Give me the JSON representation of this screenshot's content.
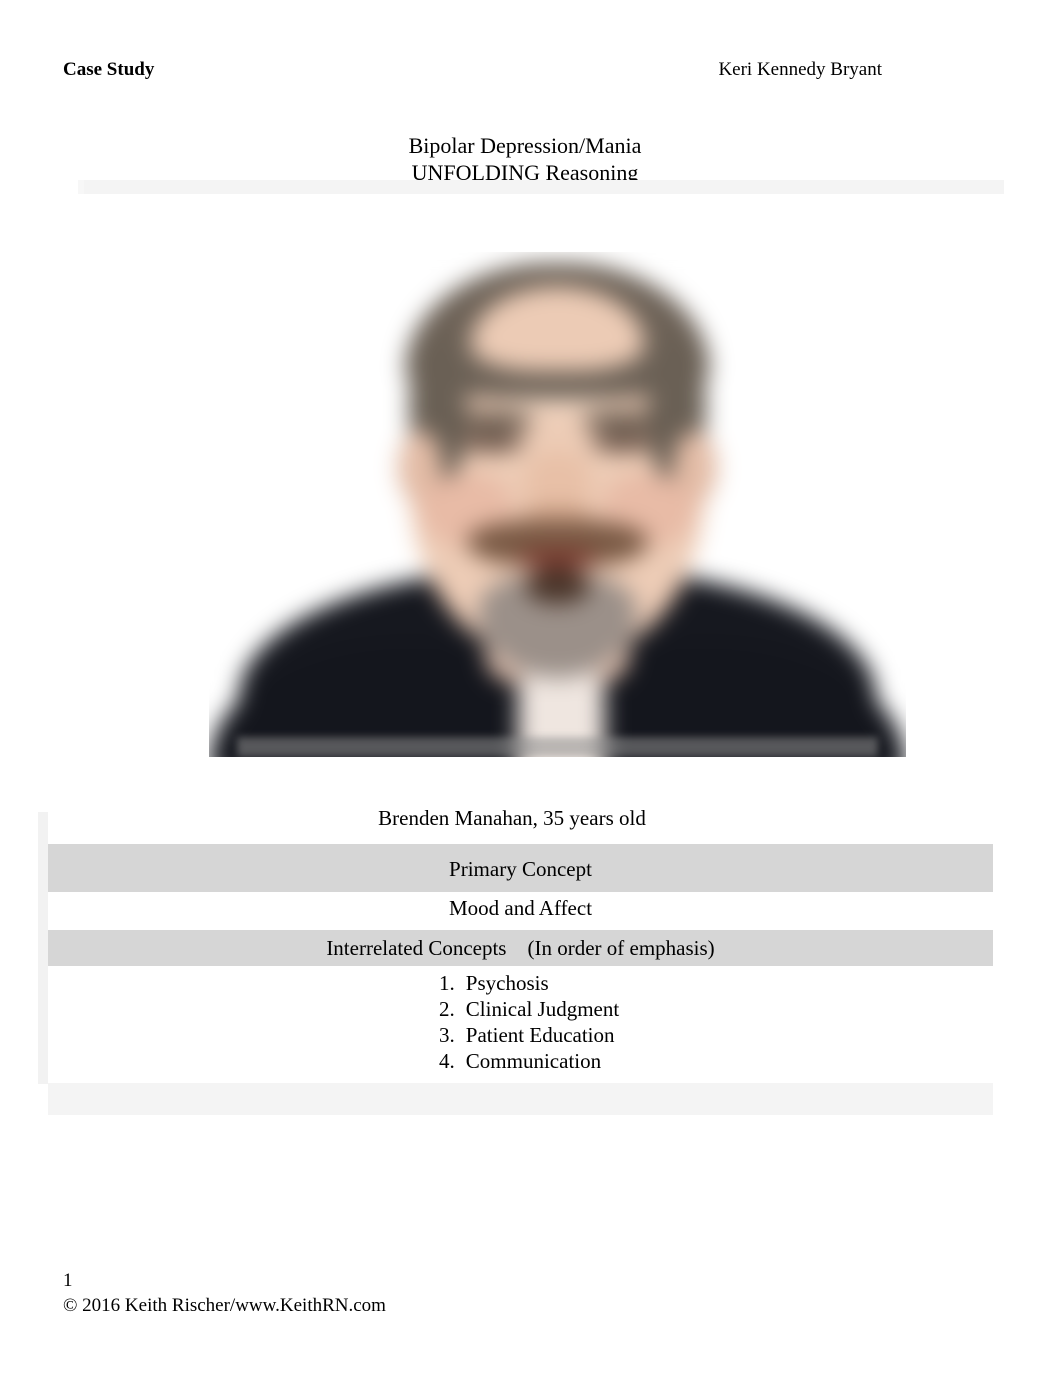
{
  "document": {
    "header": {
      "left_label": "Case Study",
      "right_label": "Keri Kennedy Bryant"
    },
    "title": {
      "line1": "Bipolar Depression/Mania",
      "line2": "UNFOLDING Reasoning"
    },
    "photo": {
      "alt": "Portrait photograph of a middle-aged man with a grey goatee wearing a dark collared shirt",
      "icon_name": "patient-portrait"
    },
    "caption": "Brenden Manahan, 35 years old",
    "concept_table": {
      "primary_concept_label": "Primary Concept",
      "primary_concept_value": "Mood and Affect",
      "interrelated_header": "Interrelated Concepts    (In order of emphasis)",
      "interrelated_concepts": [
        {
          "number": "1.",
          "label": "Psychosis"
        },
        {
          "number": "2.",
          "label": "Clinical Judgment"
        },
        {
          "number": "3.",
          "label": "Patient Education"
        },
        {
          "number": "4.",
          "label": "Communication"
        }
      ]
    },
    "footer": {
      "page_number": "1",
      "copyright": "© 2016 Keith Rischer/www.KeithRN.com"
    },
    "colors": {
      "page_background": "#ffffff",
      "text": "#000000",
      "row_shade": "#d6d6d6",
      "row_faint": "#f4f4f4",
      "left_strip": "#f2f2f2"
    }
  }
}
